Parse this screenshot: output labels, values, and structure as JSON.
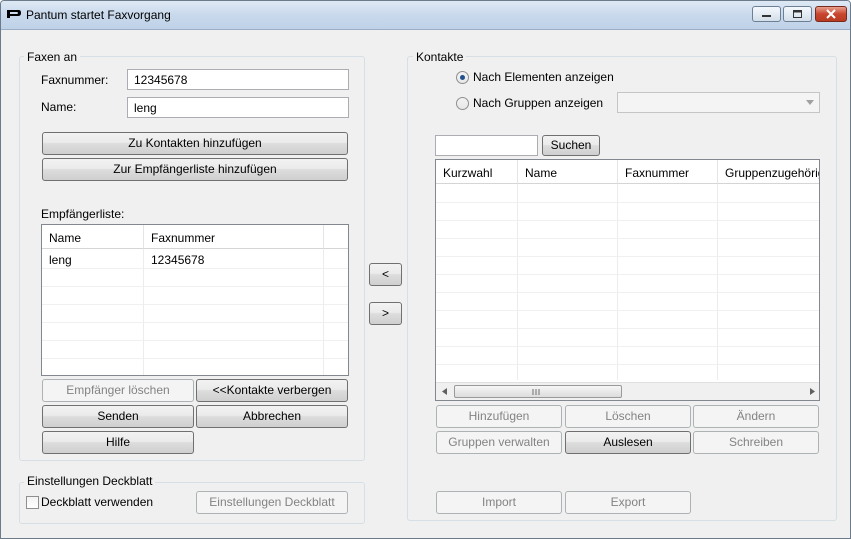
{
  "window": {
    "title": "Pantum startet Faxvorgang"
  },
  "fax_to": {
    "group_title": "Faxen an",
    "fax_number_label": "Faxnummer:",
    "fax_number_value": "12345678",
    "name_label": "Name:",
    "name_value": "leng",
    "add_to_contacts": "Zu Kontakten hinzufügen",
    "add_to_recipients": "Zur Empfängerliste hinzufügen",
    "recipient_list_label": "Empfängerliste:",
    "recipient_columns": [
      "Name",
      "Faxnummer"
    ],
    "recipients": [
      {
        "name": "leng",
        "fax": "12345678"
      }
    ],
    "delete_recipient": "Empfänger löschen",
    "hide_contacts": "<<Kontakte verbergen",
    "send": "Senden",
    "cancel": "Abbrechen",
    "help": "Hilfe"
  },
  "cover": {
    "group_title": "Einstellungen Deckblatt",
    "use_cover_label": "Deckblatt verwenden",
    "cover_settings_button": "Einstellungen Deckblatt"
  },
  "transfer": {
    "left": "<",
    "right": ">"
  },
  "contacts": {
    "group_title": "Kontakte",
    "by_elements": "Nach Elementen anzeigen",
    "by_groups": "Nach Gruppen anzeigen",
    "search_button": "Suchen",
    "columns": [
      "Kurzwahl",
      "Name",
      "Faxnummer",
      "Gruppenzugehörig"
    ],
    "add": "Hinzufügen",
    "delete": "Löschen",
    "change": "Ändern",
    "manage_groups": "Gruppen verwalten",
    "read": "Auslesen",
    "write": "Schreiben",
    "import": "Import",
    "export": "Export"
  }
}
